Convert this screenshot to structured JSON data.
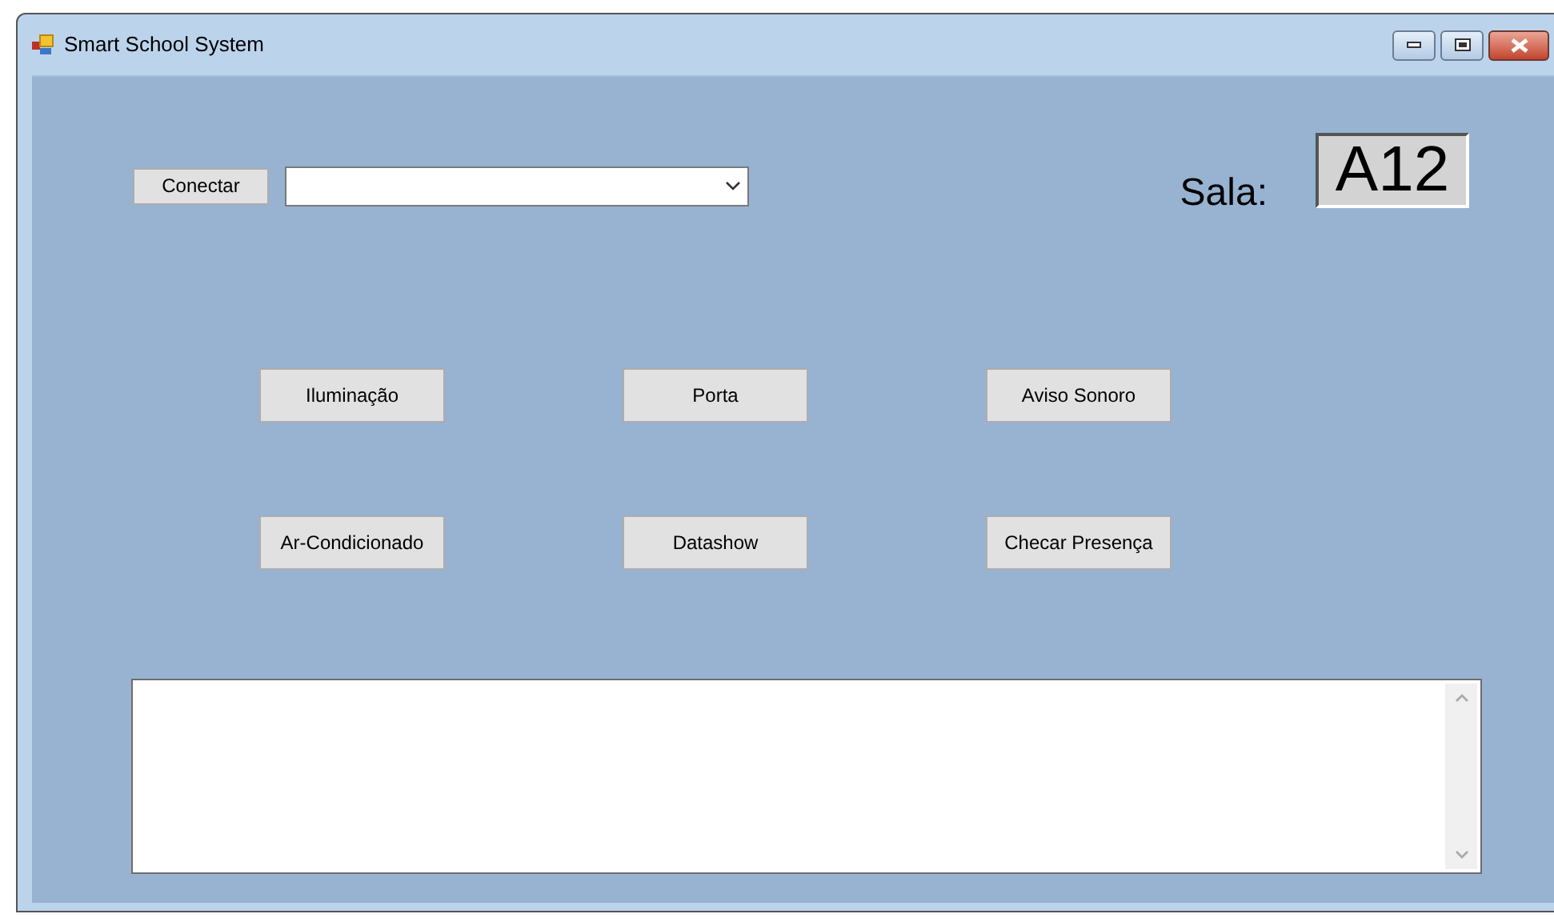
{
  "window": {
    "title": "Smart School System"
  },
  "connect_button": {
    "label": "Conectar"
  },
  "room": {
    "label": "Sala:",
    "value": "A12"
  },
  "buttons": [
    {
      "label": "Iluminação"
    },
    {
      "label": "Porta"
    },
    {
      "label": "Aviso Sonoro"
    },
    {
      "label": "Ar-Condicionado"
    },
    {
      "label": "Datashow"
    },
    {
      "label": "Checar Presença"
    }
  ]
}
